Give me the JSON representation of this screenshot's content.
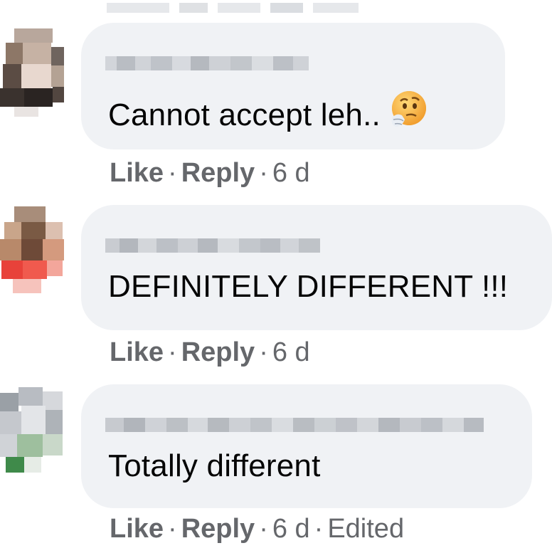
{
  "comments": [
    {
      "text": "Cannot accept leh..",
      "emoji": "thinking-face-emoji",
      "like_label": "Like",
      "reply_label": "Reply",
      "time": "6 d",
      "edited": ""
    },
    {
      "text": "DEFINITELY DIFFERENT !!!",
      "emoji": "",
      "like_label": "Like",
      "reply_label": "Reply",
      "time": "6 d",
      "edited": ""
    },
    {
      "text": "Totally different",
      "emoji": "",
      "like_label": "Like",
      "reply_label": "Reply",
      "time": "6 d",
      "edited": "Edited"
    }
  ],
  "colors": {
    "bubble": "#f0f2f5",
    "text": "#050505",
    "secondary": "#65676b"
  },
  "separator": "·"
}
